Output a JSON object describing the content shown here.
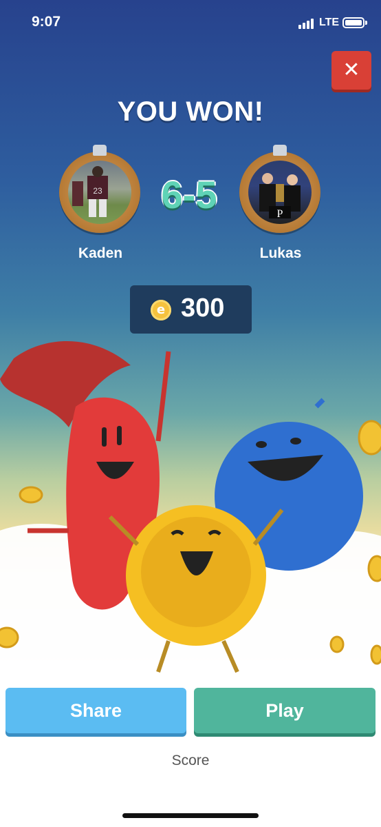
{
  "status_bar": {
    "time": "9:07",
    "network": "LTE"
  },
  "result": {
    "title": "YOU WON!",
    "score": "6-5"
  },
  "players": {
    "left": {
      "name": "Kaden"
    },
    "right": {
      "name": "Lukas"
    }
  },
  "reward": {
    "currency_symbol": "e",
    "amount": "300"
  },
  "buttons": {
    "share_label": "Share",
    "play_label": "Play",
    "close_symbol": "✕"
  },
  "footer": {
    "label": "Score"
  },
  "colors": {
    "close": "#d94036",
    "share": "#5bbcf2",
    "play": "#50b59c",
    "score": "#5fd3b6",
    "reward_box": "#1f3c5d"
  },
  "icons": {
    "close": "close-icon",
    "coin": "coin-icon",
    "signal": "signal-icon",
    "battery": "battery-icon"
  }
}
